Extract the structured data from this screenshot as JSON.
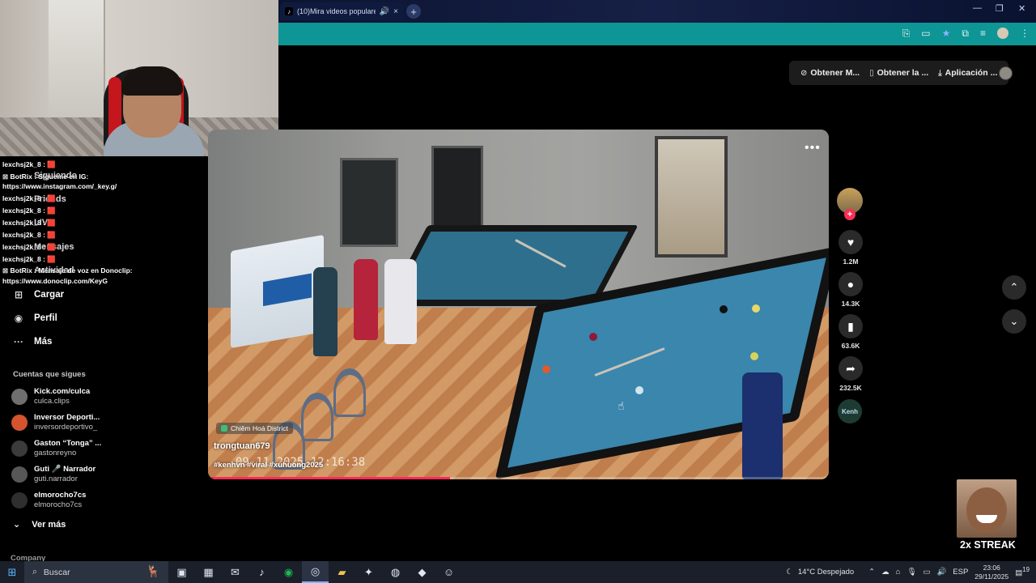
{
  "browser": {
    "tab_title": "(10)Mira videos populares",
    "tab_close": "×",
    "tab_audio_icon": "speaker-icon",
    "new_tab_label": "+",
    "window_controls": [
      "—",
      "❐",
      "✕"
    ]
  },
  "top_actions": [
    {
      "icon": "coin-icon",
      "glyph": "⊘",
      "label": "Obtener M..."
    },
    {
      "icon": "phone-icon",
      "glyph": "▯",
      "label": "Obtener la ..."
    },
    {
      "icon": "download-icon",
      "glyph": "⤓",
      "label": "Aplicación ..."
    }
  ],
  "chat": {
    "lines": [
      {
        "user": "lexchsj2k_8 :",
        "text": " 🟥"
      },
      {
        "user": "",
        "text": "⊠ BotRix : Sígueme en IG:"
      },
      {
        "user": "",
        "text": "https://www.instagram.com/_key.g/"
      },
      {
        "user": "lexchsj2k_8 :",
        "text": " 🟥"
      },
      {
        "user": "lexchsj2k_8 :",
        "text": " 🟥"
      },
      {
        "user": "lexchsj2k_8 :",
        "text": " 🟥"
      },
      {
        "user": "lexchsj2k_8 :",
        "text": " 🟥"
      },
      {
        "user": "lexchsj2k_8 :",
        "text": " 🟥"
      },
      {
        "user": "lexchsj2k_8 :",
        "text": " 🟥"
      },
      {
        "user": "",
        "text": "⊠ BotRix : Mensaje de voz en Donoclip:"
      },
      {
        "user": "",
        "text": "https://www.donoclip.com/KeyG"
      }
    ]
  },
  "sidebar": {
    "ghost_items": [
      "Siguiendo",
      "Friends",
      "LIVE",
      "Mensajes",
      "Actividad"
    ],
    "nav": [
      {
        "icon": "upload-icon",
        "glyph": "⊞",
        "label": "Cargar"
      },
      {
        "icon": "profile-icon",
        "glyph": "◉",
        "label": "Perfil"
      },
      {
        "icon": "more-icon",
        "glyph": "···",
        "label": "Más"
      }
    ],
    "following_title": "Cuentas que sigues",
    "following": [
      {
        "name": "Kick.com/culca",
        "handle": "culca.clips",
        "color": "#6f6f6f"
      },
      {
        "name": "Inversor Deporti...",
        "handle": "inversordeportivo_",
        "color": "#d3542f"
      },
      {
        "name": "Gaston “Tonga” ...",
        "handle": "gastonreyno",
        "color": "#3b3b3b"
      },
      {
        "name": "Guti 🎤 Narrador",
        "handle": "guti.narrador",
        "color": "#575757"
      },
      {
        "name": "elmorocho7cs",
        "handle": "elmorocho7cs",
        "color": "#2f2f2f"
      }
    ],
    "see_more": "Ver más",
    "company": "Company"
  },
  "video": {
    "location": "Chiêm Hoá District",
    "author": "trongtuan679",
    "tags": "#kenhvn #viral #xuhuong2025",
    "timestamp": "09-11-2025 12:16:38",
    "progress_fraction": 0.39,
    "more_label": "•••"
  },
  "rail": {
    "follow_plus": "+",
    "actions": [
      {
        "icon": "heart-icon",
        "glyph": "♥",
        "count": "1.2M"
      },
      {
        "icon": "comment-icon",
        "glyph": "●",
        "count": "14.3K"
      },
      {
        "icon": "bookmark-icon",
        "glyph": "▮",
        "count": "63.6K"
      },
      {
        "icon": "share-icon",
        "glyph": "➦",
        "count": "232.5K"
      }
    ],
    "music_label": "Kenh"
  },
  "streak": {
    "text": "2x STREAK"
  },
  "taskbar": {
    "search_placeholder": "Buscar",
    "weather": "14°C  Despejado",
    "lang": "ESP",
    "time": "23:06",
    "date": "29/11/2025",
    "notif_count": "19"
  },
  "colors": {
    "accent": "#fe2c55",
    "url_bar": "#0e9596"
  }
}
